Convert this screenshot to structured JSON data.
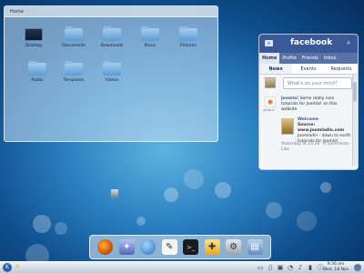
{
  "folderview": {
    "title": "Home",
    "items": [
      {
        "label": "Desktop",
        "icon": "desktop-icon"
      },
      {
        "label": "Documents",
        "icon": "folder-icon"
      },
      {
        "label": "Downloads",
        "icon": "folder-icon"
      },
      {
        "label": "Music",
        "icon": "folder-icon"
      },
      {
        "label": "Pictures",
        "icon": "folder-icon"
      },
      {
        "label": "Public",
        "icon": "folder-icon"
      },
      {
        "label": "Templates",
        "icon": "folder-icon"
      },
      {
        "label": "Videos",
        "icon": "folder-icon"
      }
    ]
  },
  "facebook": {
    "logo": "facebook",
    "nav": [
      "Home",
      "Profile",
      "Friends",
      "Inbox"
    ],
    "tabs": [
      "News",
      "Events",
      "Requests"
    ],
    "status_placeholder": "What's on your mind?",
    "post": {
      "icon_caption": "JOOMLA!",
      "author": "Joomla!",
      "message": "Some really nice tutorials for Joomla! on this website",
      "link_title": "Welcome",
      "link_source_label": "Source:",
      "link_source": "www.joomladin.com",
      "link_desc": "Joomladin - down to earth tutorials for Joomla!",
      "meta": "Yesterday at 14:26 · 0 comments · Like"
    }
  },
  "dock": {
    "apps": [
      "firefox",
      "kde",
      "web-browser",
      "text-editor",
      "terminal",
      "notes",
      "settings",
      "file-manager"
    ]
  },
  "panel": {
    "clock_time": "9:36 am",
    "clock_date": "Wed, 18 Nov"
  }
}
